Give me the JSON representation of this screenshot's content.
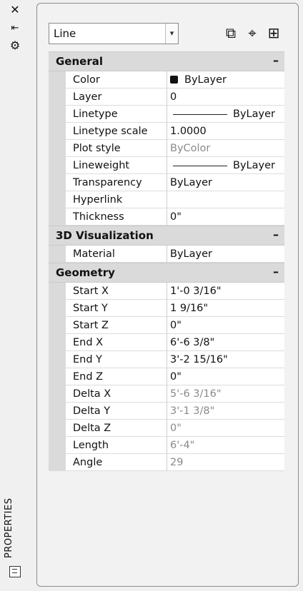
{
  "palette": {
    "title": "PROPERTIES",
    "controls": [
      "close-icon",
      "auto-hide-icon",
      "options-icon"
    ]
  },
  "selector": {
    "object_type": "Line",
    "tools": [
      "toggle-pickadd-icon",
      "select-objects-icon",
      "quick-select-icon"
    ]
  },
  "sections": {
    "general": {
      "title": "General",
      "toggle": "–",
      "rows": [
        {
          "label": "Color",
          "value": "ByLayer"
        },
        {
          "label": "Layer",
          "value": "0"
        },
        {
          "label": "Linetype",
          "value": "ByLayer"
        },
        {
          "label": "Linetype scale",
          "value": "1.0000"
        },
        {
          "label": "Plot style",
          "value": "ByColor"
        },
        {
          "label": "Lineweight",
          "value": "ByLayer"
        },
        {
          "label": "Transparency",
          "value": "ByLayer"
        },
        {
          "label": "Hyperlink",
          "value": ""
        },
        {
          "label": "Thickness",
          "value": "0\""
        }
      ]
    },
    "visualization": {
      "title": "3D Visualization",
      "toggle": "–",
      "rows": [
        {
          "label": "Material",
          "value": "ByLayer"
        }
      ]
    },
    "geometry": {
      "title": "Geometry",
      "toggle": "–",
      "rows": [
        {
          "label": "Start X",
          "value": "1'-0 3/16\""
        },
        {
          "label": "Start Y",
          "value": "1 9/16\""
        },
        {
          "label": "Start Z",
          "value": "0\""
        },
        {
          "label": "End X",
          "value": "6'-6 3/8\""
        },
        {
          "label": "End Y",
          "value": "3'-2 15/16\""
        },
        {
          "label": "End Z",
          "value": "0\""
        },
        {
          "label": "Delta X",
          "value": "5'-6 3/16\""
        },
        {
          "label": "Delta Y",
          "value": "3'-1 3/8\""
        },
        {
          "label": "Delta Z",
          "value": "0\""
        },
        {
          "label": "Length",
          "value": "6'-4\""
        },
        {
          "label": "Angle",
          "value": "29"
        }
      ]
    }
  }
}
